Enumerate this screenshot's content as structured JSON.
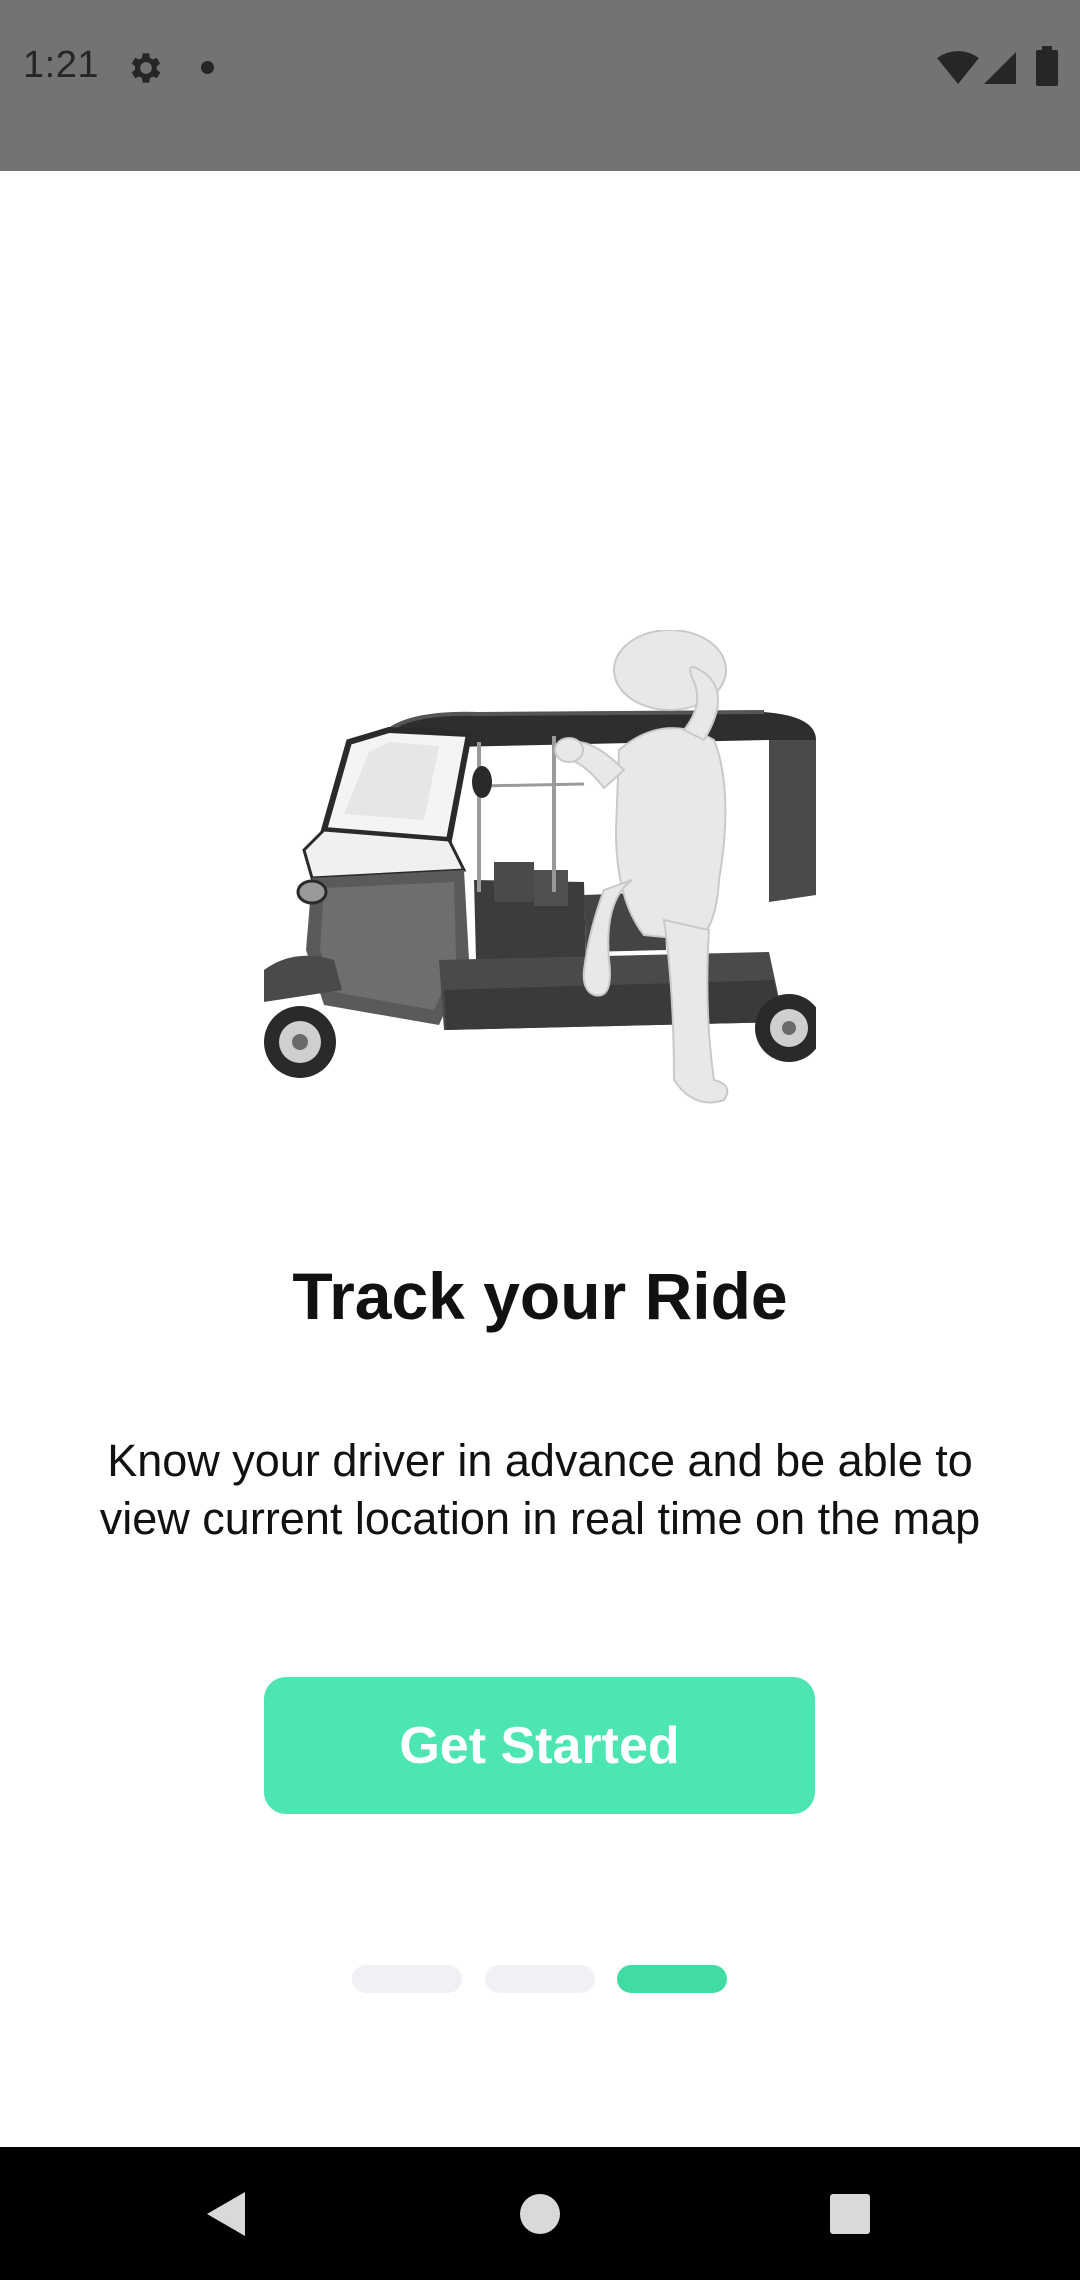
{
  "status_bar": {
    "time": "1:21",
    "icons": [
      "gear-icon",
      "notification-dot-icon",
      "wifi-icon",
      "signal-icon",
      "battery-icon"
    ]
  },
  "onboarding": {
    "illustration": "auto-rickshaw-with-passenger",
    "title": "Track your Ride",
    "description": "Know your driver in advance and be able to view current location in real time on the map",
    "cta_label": "Get Started",
    "page_count": 3,
    "current_page": 3
  },
  "nav_bar": {
    "icons": [
      "back-icon",
      "home-icon",
      "recents-icon"
    ]
  },
  "colors": {
    "accent": "#4de6b2",
    "indicator_active": "#40dca4",
    "indicator_inactive": "#f0f1f5",
    "status_bar": "#737373",
    "nav_bar": "#000000"
  }
}
